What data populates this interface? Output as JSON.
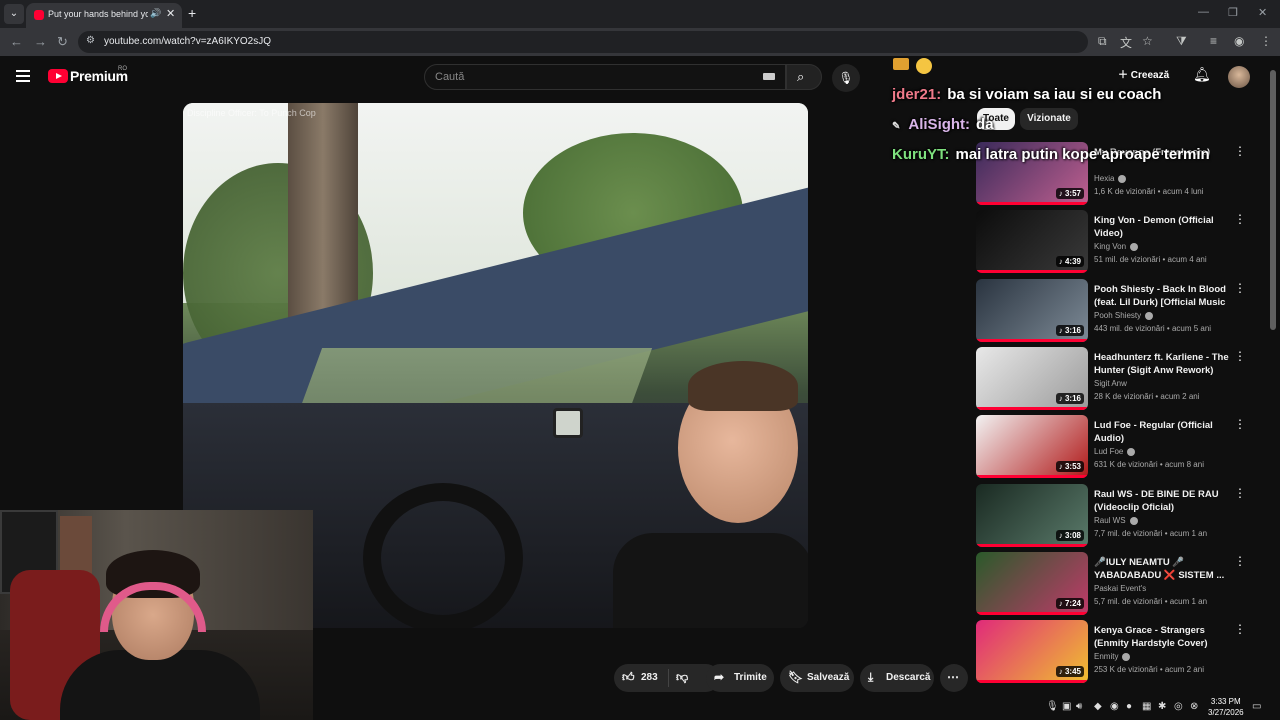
{
  "browser": {
    "tab_title": "Put your hands behind your",
    "url": "youtube.com/watch?v=zA6IKYO2sJQ",
    "new_tab": "+",
    "tab_close": "✕"
  },
  "masthead": {
    "logo_text": "Premium",
    "country_code": "RO",
    "search_placeholder": "Caută",
    "create_label": "Creează"
  },
  "video": {
    "caption": "Discipline Officer: To Punch Cop"
  },
  "actions": {
    "likes": "283",
    "share": "Trimite",
    "save": "Salvează",
    "download": "Descarcă"
  },
  "chat": [
    {
      "user": "jder21:",
      "message": "ba si voiam sa iau si eu coach",
      "color": "#f07a8a"
    },
    {
      "user": "AliSight:",
      "message": "da",
      "color": "#d8b4e8"
    },
    {
      "user": "KuruYT:",
      "message": "mai latra putin kope aproape termin",
      "color": "#7ee07e"
    }
  ],
  "chips": [
    "Toate",
    "Vizionate"
  ],
  "recommendations": [
    {
      "title": "My Revenge (Frenchcore)",
      "channel": "Hexia",
      "verified": true,
      "meta": "1,6 K de vizionări • acum 4 luni",
      "duration": "3:57",
      "thumb": [
        "#3a2a5a",
        "#c06090"
      ]
    },
    {
      "title": "King Von - Demon (Official Video)",
      "channel": "King Von",
      "verified": true,
      "meta": "51 mil. de vizionări • acum 4 ani",
      "duration": "4:39",
      "thumb": [
        "#0c0c0c",
        "#3a3a3a"
      ]
    },
    {
      "title": "Pooh Shiesty - Back In Blood (feat. Lil Durk) [Official Music ...",
      "channel": "Pooh Shiesty",
      "verified": true,
      "meta": "443 mil. de vizionări • acum 5 ani",
      "duration": "3:16",
      "thumb": [
        "#2a3440",
        "#7d8a96"
      ]
    },
    {
      "title": "Headhunterz ft. Karliene - The Hunter (Sigit Anw Rework)",
      "channel": "Sigit Anw",
      "verified": false,
      "meta": "28 K de vizionări • acum 2 ani",
      "duration": "3:16",
      "thumb": [
        "#e8e8e8",
        "#9a9a9a"
      ]
    },
    {
      "title": "Lud Foe - Regular (Official Audio)",
      "channel": "Lud Foe",
      "verified": true,
      "meta": "631 K de vizionări • acum 8 ani",
      "duration": "3:53",
      "thumb": [
        "#f2f2f2",
        "#b01818"
      ]
    },
    {
      "title": "Raul WS - DE BINE DE RAU (Videoclip Oficial)",
      "channel": "Raul WS",
      "verified": true,
      "meta": "7,7 mil. de vizionări • acum 1 an",
      "duration": "3:08",
      "thumb": [
        "#1a2a22",
        "#5a7a6a"
      ]
    },
    {
      "title": "🎤IULY NEAMTU 🎤 YABADABADU ❌ SISTEM ...",
      "channel": "Paskai Event's",
      "verified": false,
      "meta": "5,7 mil. de vizionări • acum 1 an",
      "duration": "7:24",
      "thumb": [
        "#2a5a2a",
        "#c03a6a"
      ]
    },
    {
      "title": "Kenya Grace - Strangers (Enmity Hardstyle Cover)",
      "channel": "Enmity",
      "verified": true,
      "meta": "253 K de vizionări • acum 2 ani",
      "duration": "3:45",
      "thumb": [
        "#e02a7a",
        "#f0c030"
      ]
    }
  ],
  "clock": {
    "time": "3:33 PM",
    "date": "3/27/2026"
  },
  "colors": {
    "youtube_red": "#ff0033",
    "background": "#0f0f0f"
  }
}
